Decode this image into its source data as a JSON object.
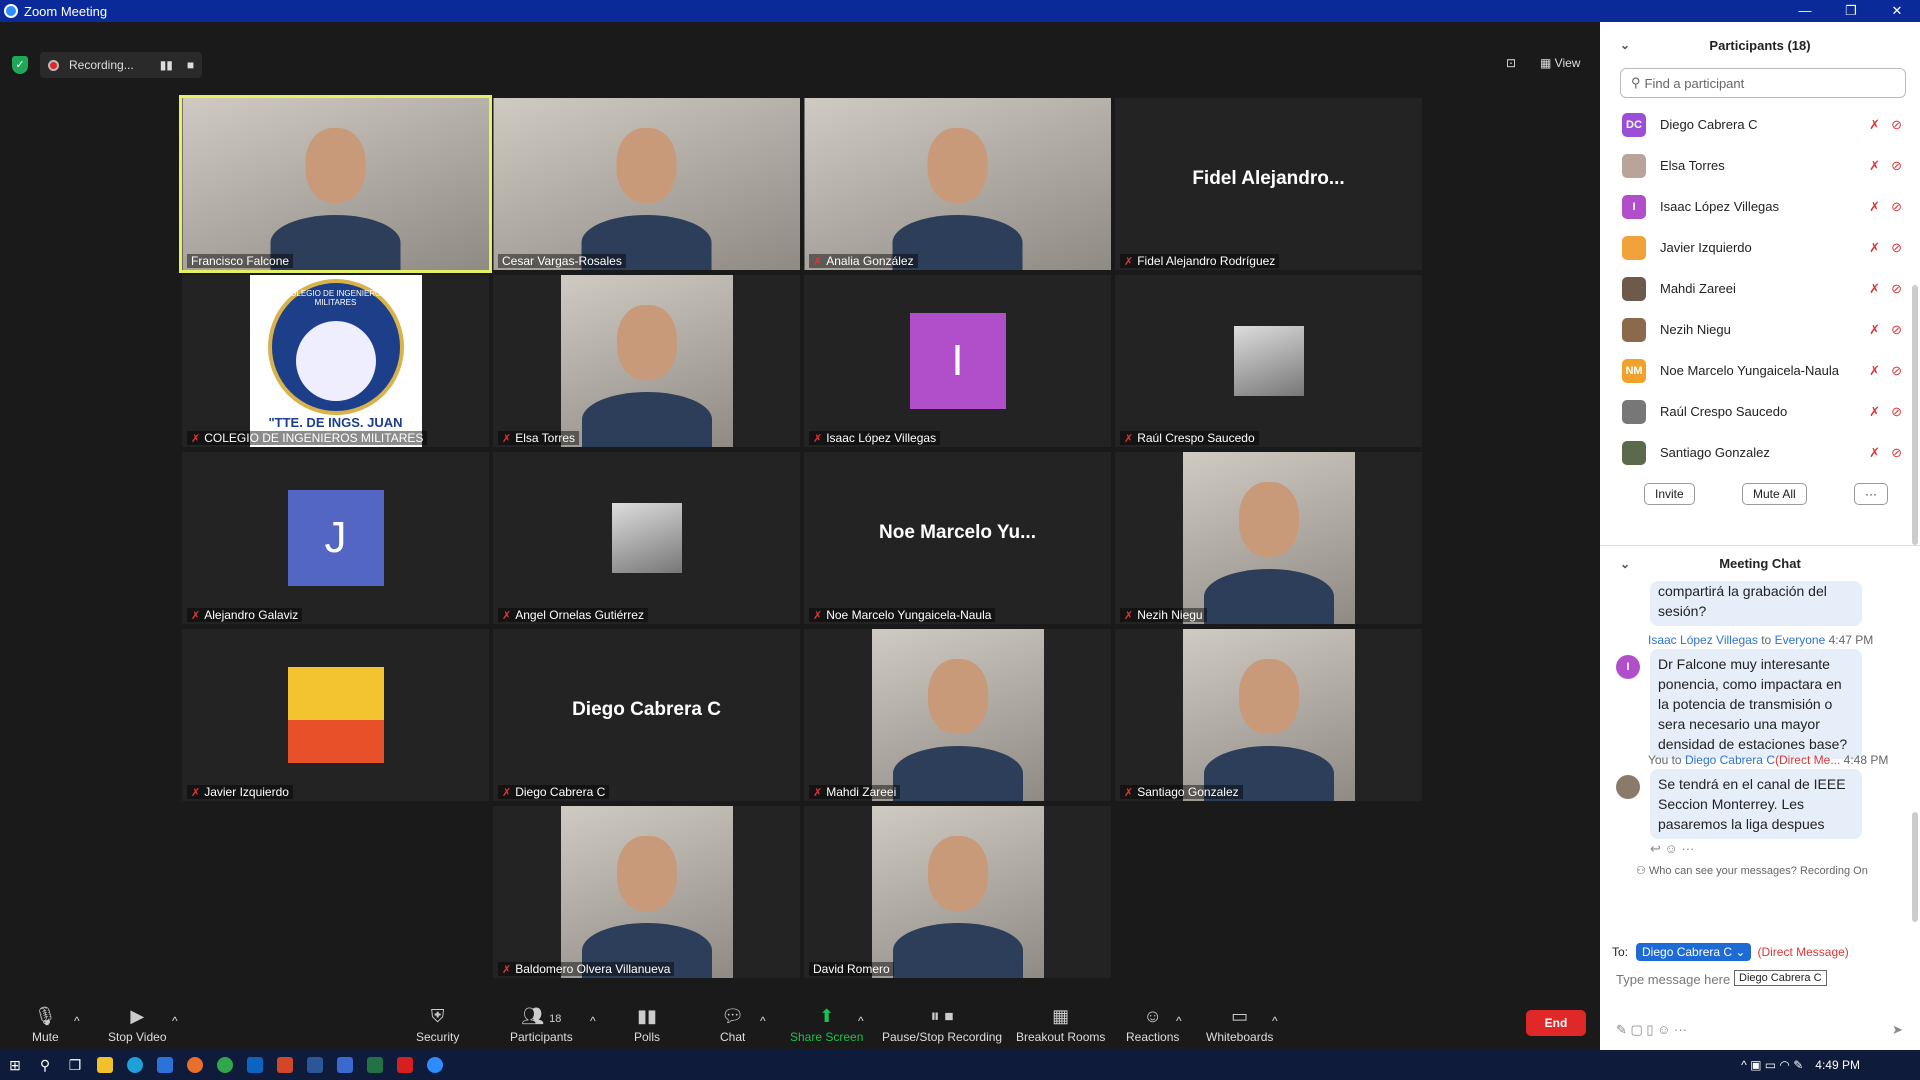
{
  "window": {
    "title": "Zoom Meeting",
    "controls": [
      "—",
      "❐",
      "✕"
    ]
  },
  "recording": {
    "label": "Recording...",
    "pause": "▮▮",
    "stop": "■"
  },
  "view": {
    "label": "View"
  },
  "tiles": [
    {
      "name": "Francisco Falcone",
      "muted": false,
      "active": true,
      "kind": "photo"
    },
    {
      "name": "Cesar Vargas-Rosales",
      "muted": false,
      "kind": "photo"
    },
    {
      "name": "Analia González",
      "muted": true,
      "kind": "photo"
    },
    {
      "name": "Fidel Alejandro Rodríguez",
      "muted": true,
      "kind": "text",
      "big": "Fidel  Alejandro..."
    },
    {
      "name": "COLEGIO DE INGENIEROS MILITARES",
      "muted": true,
      "kind": "logo",
      "logo_text": "COLEGIO DE INGENIEROS MILITARES",
      "logo_sub": "\"TTE. DE INGS. JUAN"
    },
    {
      "name": "Elsa Torres",
      "muted": true,
      "kind": "photo"
    },
    {
      "name": "Isaac López Villegas",
      "muted": true,
      "kind": "letter",
      "letter": "I",
      "color": "#b04fc9"
    },
    {
      "name": "Raúl Crespo Saucedo",
      "muted": true,
      "kind": "small"
    },
    {
      "name": "Alejandro Galaviz",
      "muted": true,
      "kind": "letter",
      "letter": "J",
      "color": "#5366c4"
    },
    {
      "name": "Angel Ornelas Gutiérrez",
      "muted": true,
      "kind": "small"
    },
    {
      "name": "Noe Marcelo Yungaicela-Naula",
      "muted": true,
      "kind": "text",
      "big": "Noe Marcelo Yu..."
    },
    {
      "name": "Nezih Niegu",
      "muted": true,
      "kind": "photo"
    },
    {
      "name": "Javier Izquierdo",
      "muted": true,
      "kind": "cartoon"
    },
    {
      "name": "Diego Cabrera C",
      "muted": true,
      "kind": "text",
      "big": "Diego Cabrera C"
    },
    {
      "name": "Mahdi Zareei",
      "muted": true,
      "kind": "photo"
    },
    {
      "name": "Santiago Gonzalez",
      "muted": true,
      "kind": "photo"
    },
    {
      "name": "Baldomero Olvera Villanueva",
      "muted": true,
      "kind": "photo"
    },
    {
      "name": "David Romero",
      "muted": false,
      "kind": "photo"
    }
  ],
  "participants": {
    "title": "Participants (18)",
    "search_placeholder": "Find a participant",
    "list": [
      {
        "name": "Diego Cabrera C",
        "initials": "DC",
        "color": "#9b4fd6"
      },
      {
        "name": "Elsa Torres",
        "initials": "",
        "color": "#b9a49a"
      },
      {
        "name": "Isaac López Villegas",
        "initials": "I",
        "color": "#b04fc9"
      },
      {
        "name": "Javier Izquierdo",
        "initials": "",
        "color": "#f2a23a"
      },
      {
        "name": "Mahdi Zareei",
        "initials": "",
        "color": "#6e5a4a"
      },
      {
        "name": "Nezih Niegu",
        "initials": "",
        "color": "#8a6a4a"
      },
      {
        "name": "Noe Marcelo Yungaicela-Naula",
        "initials": "NM",
        "color": "#f2a12a"
      },
      {
        "name": "Raúl Crespo Saucedo",
        "initials": "",
        "color": "#777"
      },
      {
        "name": "Santiago Gonzalez",
        "initials": "",
        "color": "#5a6a4a"
      }
    ],
    "invite": "Invite",
    "mute_all": "Mute All",
    "more": "···"
  },
  "chat": {
    "title": "Meeting Chat",
    "msg1": "compartirá la grabación del sesión?",
    "msg2_from": "Isaac López Villegas",
    "msg2_to": "to",
    "msg2_everyone": "Everyone",
    "msg2_time": "4:47 PM",
    "msg2": "Dr Falcone muy interesante ponencia, como impactara en la potencia de transmisión o sera necesario una mayor densidad de estaciones base?",
    "msg3_from": "You to",
    "msg3_to": "Diego Cabrera C",
    "msg3_dm": "(Direct Me...",
    "msg3_time": "4:48 PM",
    "msg3": "Se tendrá en el canal de IEEE Seccion Monterrey. Les pasaremos la liga despues",
    "who_can_see": "Who can see your messages? Recording On",
    "to_label": "To:",
    "to_value": "Diego Cabrera C",
    "direct": "(Direct Message)",
    "type_placeholder": "Type message here",
    "tooltip": "Diego Cabrera C"
  },
  "toolbar": {
    "mute": "Mute",
    "stop_video": "Stop Video",
    "security": "Security",
    "participants": "Participants",
    "participants_count": "18",
    "polls": "Polls",
    "chat": "Chat",
    "share": "Share Screen",
    "pause_rec": "Pause/Stop Recording",
    "breakout": "Breakout Rooms",
    "reactions": "Reactions",
    "whiteboards": "Whiteboards",
    "end": "End"
  },
  "taskbar": {
    "time": "4:49 PM"
  }
}
